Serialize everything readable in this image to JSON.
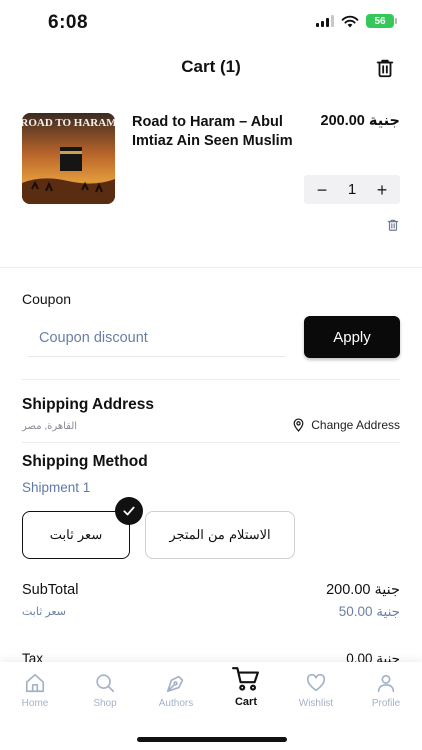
{
  "status_bar": {
    "time": "6:08",
    "battery": "56"
  },
  "header": {
    "title": "Cart (1)",
    "clear_icon": "trash-icon"
  },
  "cart_item": {
    "cover_title": "ROAD TO HARAM",
    "name": "Road to Haram – Abul Imtiaz Ain Seen Muslim",
    "price": "200.00 جنية",
    "quantity": "1",
    "minus": "−",
    "plus": "+"
  },
  "coupon": {
    "label": "Coupon",
    "placeholder": "Coupon discount",
    "apply_label": "Apply"
  },
  "shipping": {
    "title": "Shipping Address",
    "address": "القاهرة, مصر",
    "change_label": "Change Address",
    "method_title": "Shipping Method",
    "shipment_label": "Shipment 1",
    "options": [
      "سعر ثابت",
      "الاستلام من المتجر"
    ],
    "selected_option": "سعر ثابت"
  },
  "totals": {
    "subtotal_label": "SubTotal",
    "subtotal_value": "200.00 جنية",
    "fee_label": "سعر ثابت",
    "fee_value": "50.00 جنية",
    "tax_label": "Tax",
    "tax_value": "0.00 جنية"
  },
  "tabs": [
    {
      "label": "Home",
      "icon": "home-icon"
    },
    {
      "label": "Shop",
      "icon": "search-icon"
    },
    {
      "label": "Authors",
      "icon": "pen-nib-icon"
    },
    {
      "label": "Cart",
      "icon": "cart-icon"
    },
    {
      "label": "Wishlist",
      "icon": "heart-icon"
    },
    {
      "label": "Profile",
      "icon": "person-icon"
    }
  ],
  "active_tab": "Cart",
  "colors": {
    "accent_dark": "#0a0a0a",
    "muted_blue": "#6a7fa8",
    "tab_inactive": "#a3b1c7",
    "battery_green": "#34c759"
  }
}
